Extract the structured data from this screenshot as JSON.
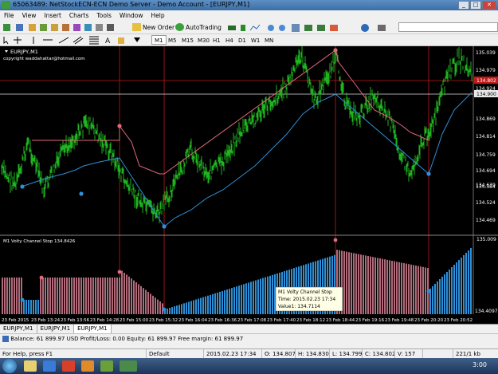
{
  "window": {
    "title": "65063489: NetStockECN-ECN Demo Server - Demo Account - [EURJPY,M1]"
  },
  "menu": [
    "File",
    "View",
    "Insert",
    "Charts",
    "Tools",
    "Window",
    "Help"
  ],
  "toolbar": {
    "new_order": "New Order",
    "autotrading": "AutoTrading"
  },
  "timeframes": [
    "M1",
    "M5",
    "M15",
    "M30",
    "H1",
    "H4",
    "D1",
    "W1",
    "MN"
  ],
  "active_timeframe": "M1",
  "chart": {
    "symbol_label": "EURJPY,M1",
    "copyright": "copyright waddahattar@hotmail.com",
    "price_labels": [
      "135.039",
      "134.979",
      "134.924",
      "134.869",
      "134.814",
      "134.759",
      "134.694",
      "134.639",
      "134.584",
      "134.524",
      "134.469"
    ],
    "current_price_red": "134.802",
    "current_price_white": "134.900",
    "indicator_label": "M1  Volty Channel Stop 134.8426",
    "indicator_top": "135.009",
    "indicator_bottom": "134.4097",
    "tooltip": {
      "line1": "M1  Volty Channel Stop",
      "line2": "Time: 2015.02.23 17:34",
      "line3": "Value1: 134.7114"
    },
    "time_labels": [
      "23 Feb 2015",
      "23 Feb 13:24",
      "23 Feb 13:56",
      "23 Feb 14:28",
      "23 Feb 15:00",
      "23 Feb 15:32",
      "23 Feb 16:04",
      "23 Feb 16:36",
      "23 Feb 17:08",
      "23 Feb 17:40",
      "23 Feb 18:12",
      "23 Feb 18:44",
      "23 Feb 19:16",
      "23 Feb 19:48",
      "23 Feb 20:20",
      "23 Feb 20:52"
    ],
    "colors": {
      "candles": "#1fb31f",
      "upper_stop": "#e06a7a",
      "lower_stop": "#2f8fd6",
      "vline": "#c01818",
      "hist_red": "#b06a7a",
      "hist_blue": "#2f8fd6"
    }
  },
  "tabs": [
    "EURJPY,M1",
    "EURJPY,M1",
    "EURJPY,M1"
  ],
  "active_tab": 2,
  "status_info": "Balance: 61 899.97 USD  Profit/Loss: 0.00  Equity: 61 899.97  Free margin: 61 899.97",
  "statusbar": {
    "help": "For Help, press F1",
    "profile": "Default",
    "time": "2015.02.23 17:34",
    "open": "O: 134.807",
    "high": "H: 134.830",
    "low": "L: 134.799",
    "close": "C: 134.802",
    "volume": "V: 157",
    "traffic": "221/1 kb"
  },
  "taskbar": {
    "clock": "3:00"
  }
}
